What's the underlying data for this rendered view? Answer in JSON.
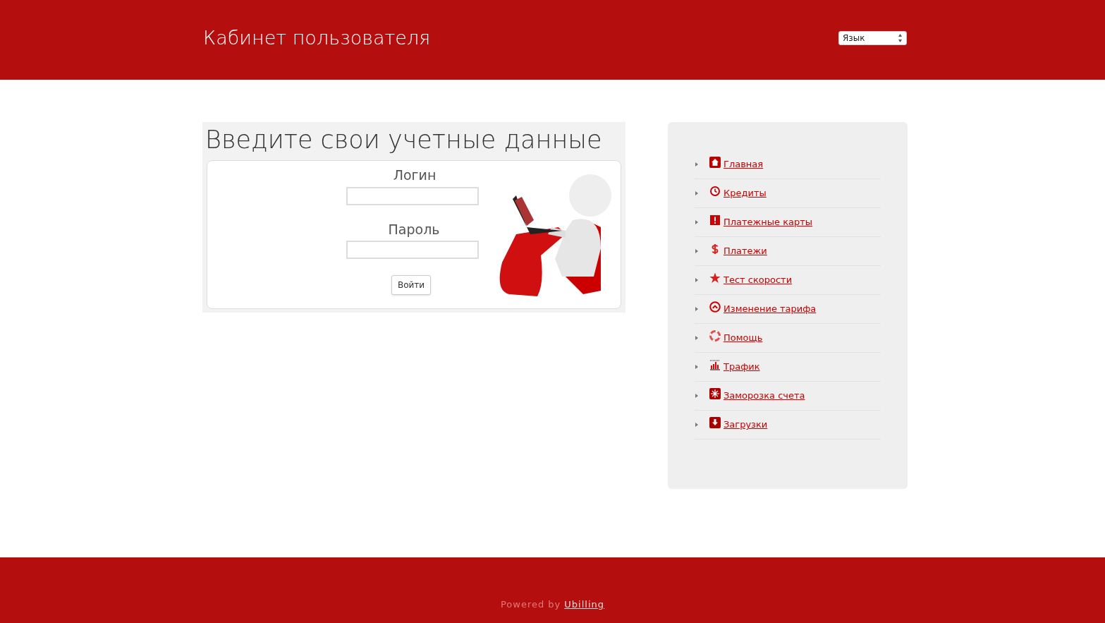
{
  "header": {
    "title": "Кабинет пользователя",
    "language_select": {
      "value": "Язык"
    }
  },
  "login": {
    "heading": "Введите свои учетные данные",
    "login_label": "Логин",
    "password_label": "Пароль",
    "submit": "Войти"
  },
  "menu": {
    "items": [
      {
        "kind": "home",
        "label": "Главная"
      },
      {
        "kind": "clock",
        "label": "Кредиты"
      },
      {
        "kind": "alert",
        "label": "Платежные карты"
      },
      {
        "kind": "dollar",
        "label": "Платежи"
      },
      {
        "kind": "star",
        "label": "Тест скорости"
      },
      {
        "kind": "up",
        "label": "Изменение тарифа"
      },
      {
        "kind": "lifebuoy",
        "label": "Помощь"
      },
      {
        "kind": "chart",
        "label": "Трафик"
      },
      {
        "kind": "snow",
        "label": "Заморозка счета"
      },
      {
        "kind": "download",
        "label": "Загрузки"
      }
    ]
  },
  "footer": {
    "text": "Powered by",
    "link": "Ubilling"
  }
}
